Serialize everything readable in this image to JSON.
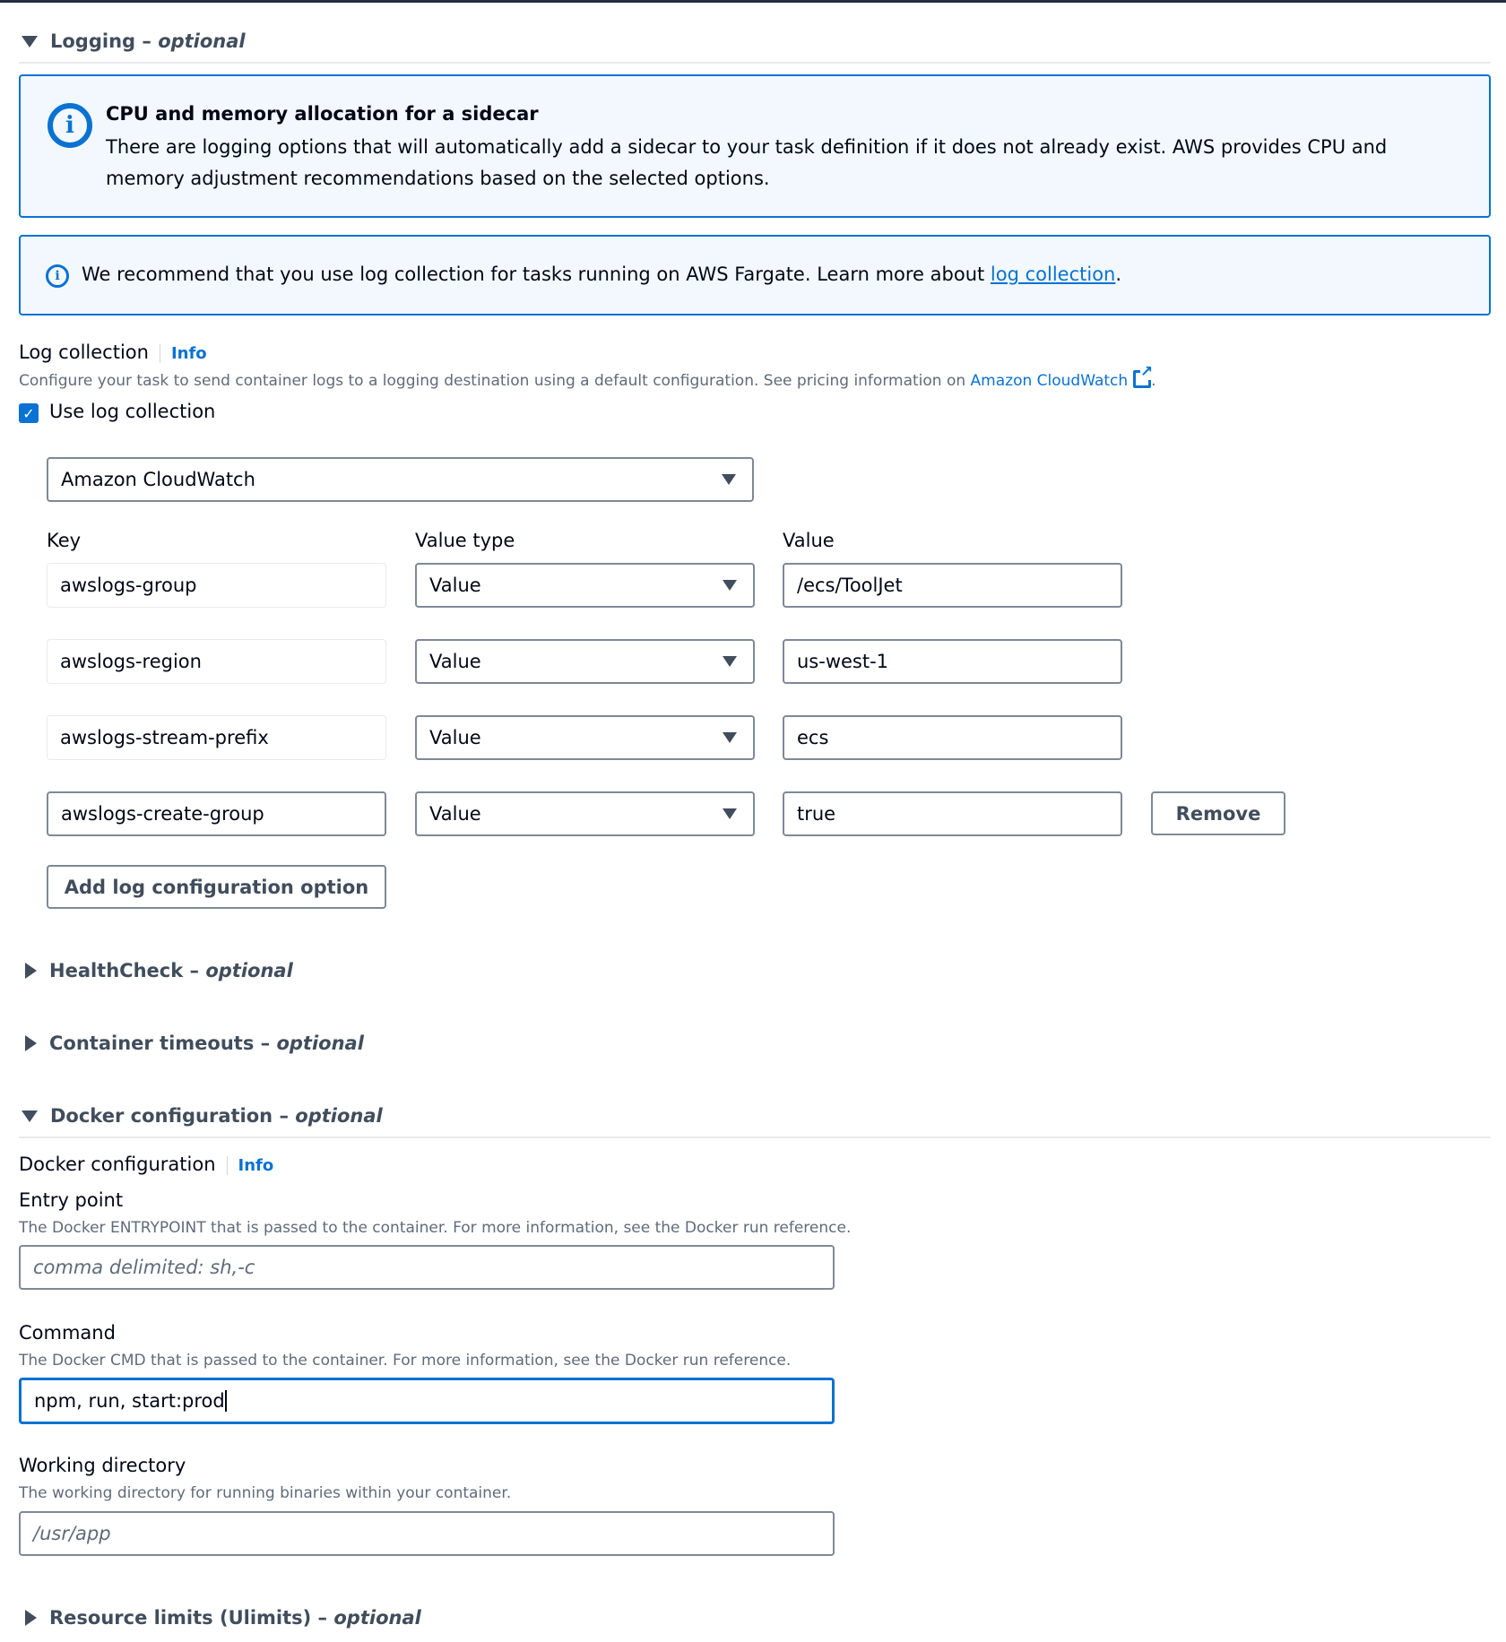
{
  "logging": {
    "title": "Logging",
    "optional": "optional",
    "expanded": true,
    "sidecar_alert": {
      "icon": "info-icon",
      "title": "CPU and memory allocation for a sidecar",
      "body": "There are logging options that will automatically add a sidecar to your task definition if it does not already exist. AWS provides CPU and memory adjustment recommendations based on the selected options."
    },
    "fargate_alert": {
      "icon": "info-icon",
      "text_before": "We recommend that you use log collection for tasks running on AWS Fargate. Learn more about ",
      "link": "log collection",
      "text_after": "."
    },
    "log_collection": {
      "label": "Log collection",
      "info": "Info",
      "description_before": "Configure your task to send container logs to a logging destination using a default configuration. See pricing information on ",
      "description_link": "Amazon CloudWatch",
      "description_after": ".",
      "checkbox_label": "Use log collection",
      "checked": true,
      "destination": "Amazon CloudWatch"
    },
    "columns": {
      "key": "Key",
      "value_type": "Value type",
      "value": "Value"
    },
    "options": [
      {
        "key": "awslogs-group",
        "value_type": "Value",
        "value": "/ecs/ToolJet",
        "editable_key": false
      },
      {
        "key": "awslogs-region",
        "value_type": "Value",
        "value": "us-west-1",
        "editable_key": false
      },
      {
        "key": "awslogs-stream-prefix",
        "value_type": "Value",
        "value": "ecs",
        "editable_key": false
      },
      {
        "key": "awslogs-create-group",
        "value_type": "Value",
        "value": "true",
        "editable_key": true
      }
    ],
    "remove_label": "Remove",
    "add_label": "Add log configuration option"
  },
  "sections": {
    "healthcheck": {
      "title": "HealthCheck",
      "optional": "optional",
      "expanded": false
    },
    "timeouts": {
      "title": "Container timeouts",
      "optional": "optional",
      "expanded": false
    },
    "docker": {
      "title": "Docker configuration",
      "optional": "optional",
      "expanded": true
    },
    "ulimits": {
      "title": "Resource limits (Ulimits)",
      "optional": "optional",
      "expanded": false
    }
  },
  "docker": {
    "label": "Docker configuration",
    "info": "Info",
    "entry_point": {
      "label": "Entry point",
      "description": "The Docker ENTRYPOINT that is passed to the container. For more information, see the Docker run reference.",
      "placeholder": "comma delimited: sh,-c",
      "value": ""
    },
    "command": {
      "label": "Command",
      "description": "The Docker CMD that is passed to the container. For more information, see the Docker run reference.",
      "value": "npm, run, start:prod"
    },
    "working_directory": {
      "label": "Working directory",
      "description": "The working directory for running binaries within your container.",
      "placeholder": "/usr/app",
      "value": ""
    }
  }
}
